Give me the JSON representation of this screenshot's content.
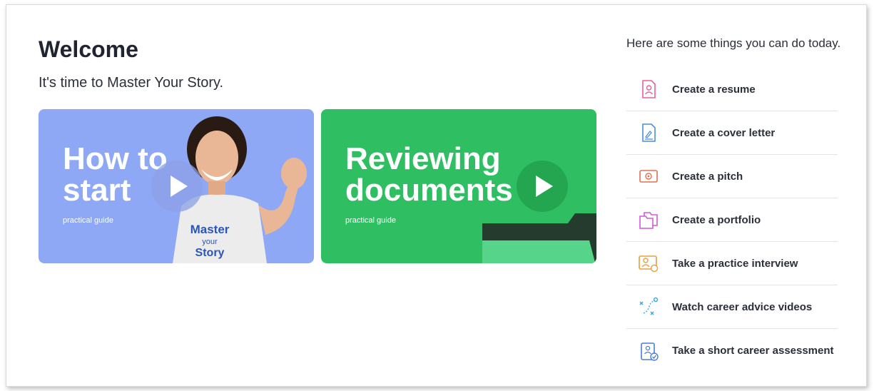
{
  "welcome": {
    "title": "Welcome",
    "subtitle": "It's time to Master Your Story."
  },
  "cards": [
    {
      "title": "How to\nstart",
      "subtitle": "practical guide",
      "color": "#8ea8f6",
      "shirt_text": [
        "Master",
        "your",
        "Story"
      ]
    },
    {
      "title": "Reviewing\ndocuments",
      "subtitle": "practical guide",
      "color": "#2fbf62"
    }
  ],
  "actions": {
    "heading": "Here are some things you can do today.",
    "items": [
      {
        "label": "Create a resume",
        "icon": "resume-icon",
        "color": "#e8609a"
      },
      {
        "label": "Create a cover letter",
        "icon": "cover-letter-icon",
        "color": "#4a8fe0"
      },
      {
        "label": "Create a pitch",
        "icon": "pitch-icon",
        "color": "#e07050"
      },
      {
        "label": "Create a portfolio",
        "icon": "portfolio-icon",
        "color": "#d05ad8"
      },
      {
        "label": "Take a practice interview",
        "icon": "interview-icon",
        "color": "#e8a040"
      },
      {
        "label": "Watch career advice videos",
        "icon": "career-videos-icon",
        "color": "#3aa8e0"
      },
      {
        "label": "Take a short career assessment",
        "icon": "assessment-icon",
        "color": "#4a7fd8"
      }
    ]
  }
}
